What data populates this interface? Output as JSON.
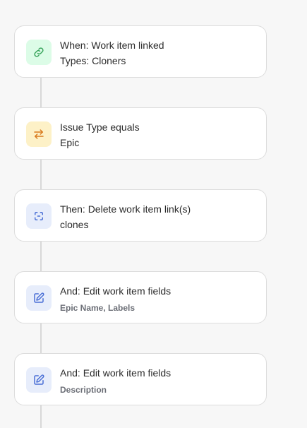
{
  "steps": [
    {
      "title": "When: Work item linked",
      "subtitle": "Types: Cloners",
      "icon": "link-icon",
      "icon_bg": "#dcfce7",
      "icon_color": "#3aa55d"
    },
    {
      "title": "Issue Type equals",
      "subtitle": "Epic",
      "icon": "swap-arrows-icon",
      "icon_bg": "#fdf1c7",
      "icon_color": "#d97a1e"
    },
    {
      "title": "Then: Delete work item link(s)",
      "subtitle": "clones",
      "icon": "broken-link-icon",
      "icon_bg": "#e7edfb",
      "icon_color": "#4a6fd6"
    },
    {
      "title": "And: Edit work item fields",
      "subtitle": "Epic Name, Labels",
      "icon": "edit-icon",
      "icon_bg": "#e7edfb",
      "icon_color": "#4a6fd6"
    },
    {
      "title": "And: Edit work item fields",
      "subtitle": "Description",
      "icon": "edit-icon",
      "icon_bg": "#e7edfb",
      "icon_color": "#4a6fd6"
    }
  ]
}
